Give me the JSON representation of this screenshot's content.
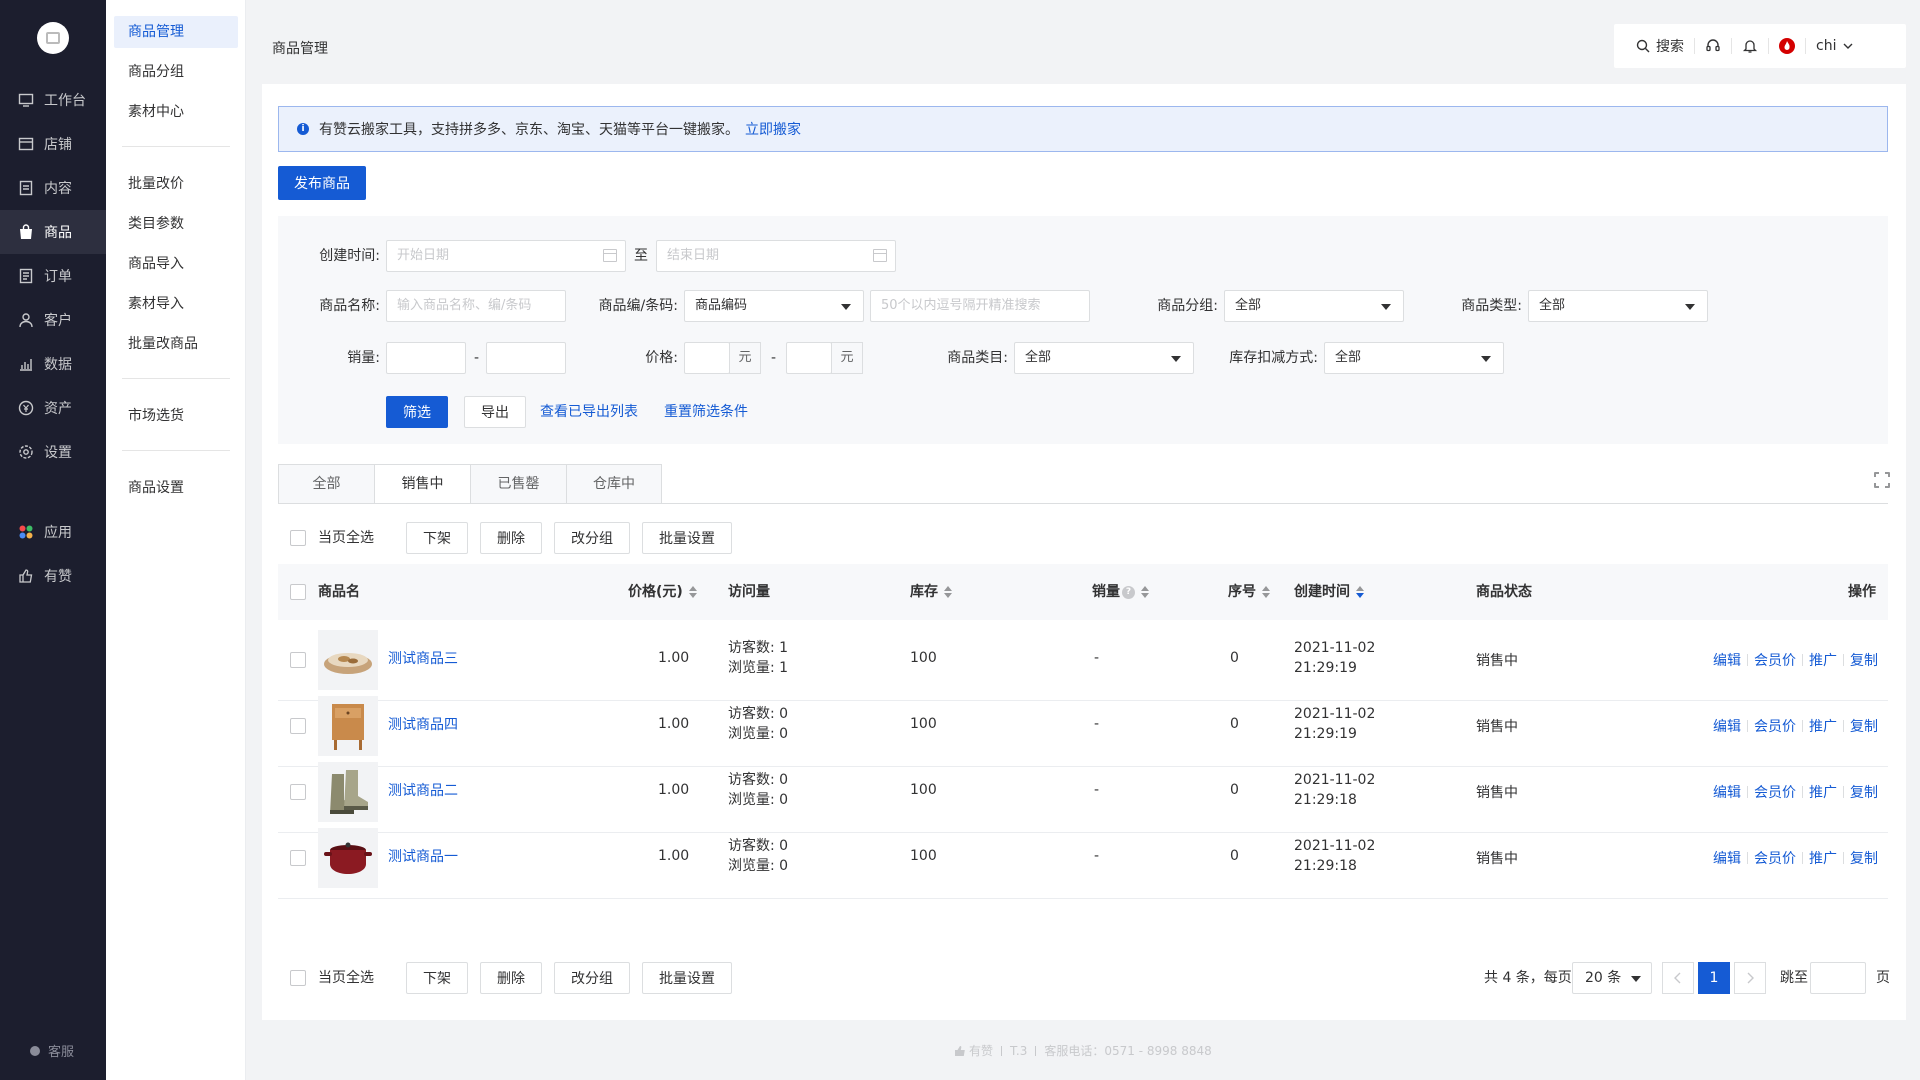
{
  "sidebar": {
    "items": [
      {
        "label": "工作台",
        "icon": "workbench-icon"
      },
      {
        "label": "店铺",
        "icon": "store-icon"
      },
      {
        "label": "内容",
        "icon": "content-icon"
      },
      {
        "label": "商品",
        "icon": "goods-icon"
      },
      {
        "label": "订单",
        "icon": "order-icon"
      },
      {
        "label": "客户",
        "icon": "customer-icon"
      },
      {
        "label": "数据",
        "icon": "data-icon"
      },
      {
        "label": "资产",
        "icon": "asset-icon"
      },
      {
        "label": "设置",
        "icon": "settings-icon"
      },
      {
        "label": "应用",
        "icon": "apps-icon"
      },
      {
        "label": "有赞",
        "icon": "youzan-icon"
      }
    ],
    "service": "客服"
  },
  "subnav": {
    "items": [
      "商品管理",
      "商品分组",
      "素材中心",
      "批量改价",
      "类目参数",
      "商品导入",
      "素材导入",
      "批量改商品",
      "市场选货",
      "商品设置"
    ]
  },
  "header": {
    "title": "商品管理",
    "search": "搜索",
    "user": "chi"
  },
  "notice": {
    "text": "有赞云搬家工具，支持拼多多、京东、淘宝、天猫等平台一键搬家。",
    "link": "立即搬家"
  },
  "publish_button": "发布商品",
  "filter": {
    "created_label": "创建时间:",
    "start_placeholder": "开始日期",
    "to": "至",
    "end_placeholder": "结束日期",
    "name_label": "商品名称:",
    "name_placeholder": "输入商品名称、编/条码",
    "code_label": "商品编/条码:",
    "code_type": "商品编码",
    "code_placeholder": "50个以内逗号隔开精准搜索",
    "group_label": "商品分组:",
    "group_value": "全部",
    "type_label": "商品类型:",
    "type_value": "全部",
    "sales_label": "销量:",
    "dash": "-",
    "price_label": "价格:",
    "yuan": "元",
    "category_label": "商品类目:",
    "category_value": "全部",
    "stock_label": "库存扣减方式:",
    "stock_value": "全部",
    "filter_btn": "筛选",
    "export_btn": "导出",
    "view_exports": "查看已导出列表",
    "reset": "重置筛选条件"
  },
  "tabs": [
    "全部",
    "销售中",
    "已售罄",
    "仓库中"
  ],
  "bulk": {
    "select_page": "当页全选",
    "off_shelf": "下架",
    "delete": "删除",
    "change_group": "改分组",
    "batch_settings": "批量设置"
  },
  "table": {
    "columns": {
      "name": "商品名",
      "price": "价格(元)",
      "visits": "访问量",
      "stock": "库存",
      "sales": "销量",
      "seq": "序号",
      "created": "创建时间",
      "status": "商品状态",
      "ops": "操作"
    },
    "rows": [
      {
        "name": "测试商品三",
        "price": "1.00",
        "visitors": "访客数: 1",
        "views": "浏览量: 1",
        "stock": "100",
        "sales": "-",
        "seq": "0",
        "date": "2021-11-02",
        "time": "21:29:19",
        "status": "销售中",
        "thumb": "bowl"
      },
      {
        "name": "测试商品四",
        "price": "1.00",
        "visitors": "访客数: 0",
        "views": "浏览量: 0",
        "stock": "100",
        "sales": "-",
        "seq": "0",
        "date": "2021-11-02",
        "time": "21:29:19",
        "status": "销售中",
        "thumb": "cabinet"
      },
      {
        "name": "测试商品二",
        "price": "1.00",
        "visitors": "访客数: 0",
        "views": "浏览量: 0",
        "stock": "100",
        "sales": "-",
        "seq": "0",
        "date": "2021-11-02",
        "time": "21:29:18",
        "status": "销售中",
        "thumb": "shoes"
      },
      {
        "name": "测试商品一",
        "price": "1.00",
        "visitors": "访客数: 0",
        "views": "浏览量: 0",
        "stock": "100",
        "sales": "-",
        "seq": "0",
        "date": "2021-11-02",
        "time": "21:29:18",
        "status": "销售中",
        "thumb": "pot"
      }
    ],
    "ops": [
      "编辑",
      "会员价",
      "推广",
      "复制"
    ]
  },
  "pagination": {
    "total": "共 4 条，每页",
    "page_size": "20 条",
    "current": "1",
    "jump": "跳至",
    "page": "页"
  },
  "footer": {
    "brand": "有赞",
    "version": "T.3",
    "phone": "客服电话：0571 - 8998 8848"
  }
}
